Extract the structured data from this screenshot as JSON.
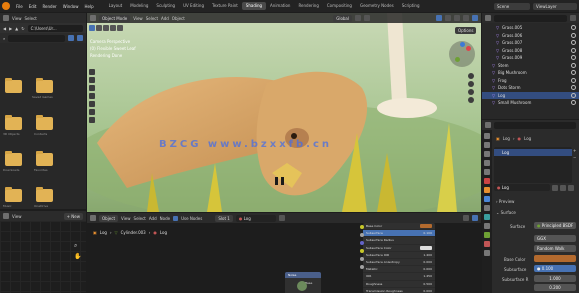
{
  "menubar": {
    "menus": [
      "File",
      "Edit",
      "Render",
      "Window",
      "Help"
    ],
    "workspaces": [
      "Layout",
      "Modeling",
      "Sculpting",
      "UV Editing",
      "Texture Paint",
      "Shading",
      "Animation",
      "Rendering",
      "Compositing",
      "Geometry Nodes",
      "Scripting"
    ],
    "active_workspace": "Shading",
    "scene_label": "Scene",
    "viewlayer_label": "ViewLayer"
  },
  "file_browser": {
    "menus": [
      "View",
      "Select"
    ],
    "path": "C:\\Users\\Ur...",
    "folders": [
      {
        "name": ""
      },
      {
        "name": "Saved Games"
      },
      {
        "name": "3D Objects"
      },
      {
        "name": "Contacts"
      },
      {
        "name": "Downloads"
      },
      {
        "name": "Favorites"
      },
      {
        "name": "Music"
      },
      {
        "name": "OneDrive"
      },
      {
        "name": ""
      },
      {
        "name": ""
      }
    ]
  },
  "image_editor": {
    "menus": [
      "View"
    ],
    "new_label": "New"
  },
  "viewport": {
    "editor_menus": [
      "Object Mode",
      "View",
      "Select",
      "Add",
      "Object"
    ],
    "transform": "Global",
    "camera_label": "Camera Perspective",
    "collection_label": "(0) Flexible Sweet Leaf",
    "status_label": "Rendering Done",
    "options_label": "Options",
    "watermark": "BZCG  www.bzxxfb.cn"
  },
  "outliner": {
    "items": [
      {
        "name": "Grass.005",
        "selected": false
      },
      {
        "name": "Grass.006",
        "selected": false
      },
      {
        "name": "Grass.007",
        "selected": false
      },
      {
        "name": "Grass.008",
        "selected": false
      },
      {
        "name": "Grass.009",
        "selected": false
      },
      {
        "name": "Stem",
        "selected": false
      },
      {
        "name": "Big Mushroom",
        "selected": false
      },
      {
        "name": "Frog",
        "selected": false
      },
      {
        "name": "Dots Storm",
        "selected": false
      },
      {
        "name": "Log",
        "selected": true
      },
      {
        "name": "Small Mushroom",
        "selected": false
      }
    ]
  },
  "properties": {
    "breadcrumb_object": "Log",
    "breadcrumb_material": "Log",
    "material_slot": "Log",
    "material_name": "Log",
    "preview_label": "Preview",
    "surface_section": "Surface",
    "surface_label": "Surface",
    "surface_value": "Principled BSDF",
    "ggx_value": "GGX",
    "random_walk_value": "Random Walk",
    "rows": [
      {
        "label": "Base Color",
        "value": ""
      },
      {
        "label": "Subsurface",
        "value": "0.100"
      },
      {
        "label": "Subsurface R",
        "value": "1.000"
      },
      {
        "label": "",
        "value": "0.200"
      }
    ]
  },
  "node_editor": {
    "editor_menus": [
      "Object",
      "View",
      "Select",
      "Add",
      "Node"
    ],
    "use_nodes_label": "Use Nodes",
    "slot_label": "Slot 1",
    "material_label": "Log",
    "breadcrumb": [
      "Log",
      "Cylinder.003",
      "Log"
    ],
    "principled_rows": [
      {
        "label": "Base Color",
        "value": ""
      },
      {
        "label": "Subsurface",
        "value": "0.100"
      },
      {
        "label": "Subsurface Radius",
        "value": ""
      },
      {
        "label": "Subsurface Color",
        "value": ""
      },
      {
        "label": "Subsurface IOR",
        "value": "1.400"
      },
      {
        "label": "Subsurface Anisotropy",
        "value": "0.000"
      },
      {
        "label": "Metallic",
        "value": "0.000"
      },
      {
        "label": "IOR",
        "value": "1.450"
      },
      {
        "label": "Roughness",
        "value": "0.500"
      },
      {
        "label": "Transmission Roughness",
        "value": "0.000"
      },
      {
        "label": "Normal",
        "value": ""
      },
      {
        "label": "Clearcoat Normal",
        "value": ""
      },
      {
        "label": "Tangent",
        "value": ""
      }
    ],
    "small_node_title": "Noise",
    "small_node_label": "Base"
  },
  "colors": {
    "accent": "#4772b3",
    "selection": "#334d80",
    "folder": "#e2b355",
    "blender_orange": "#e87d0d"
  }
}
